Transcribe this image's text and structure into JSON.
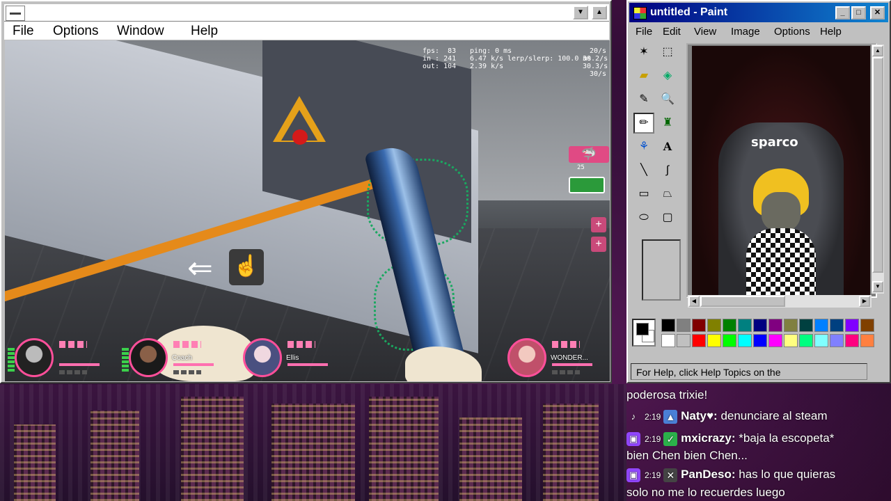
{
  "game_window": {
    "menu": [
      "File",
      "Options",
      "Window",
      "Help"
    ],
    "hud": {
      "fps": "fps:  83",
      "in": "in : 241",
      "out": "out: 104",
      "ping": "ping: 0 ms",
      "in_rate": "6.47 k/s",
      "out_rate": "2.39 k/s",
      "slerp": "lerp/slerp: 100.0 ms",
      "rate1": "20/s",
      "rate2": "30.2/s",
      "rate3": "30.3/s",
      "rate4": "30/s",
      "badge_count": "25"
    },
    "players": [
      {
        "name": ""
      },
      {
        "name": "Coach"
      },
      {
        "name": "Ellis"
      },
      {
        "name": "WONDER..."
      }
    ]
  },
  "paint": {
    "title": "untitled - Paint",
    "menu": [
      "File",
      "Edit",
      "View",
      "Image",
      "Options",
      "Help"
    ],
    "tools": [
      "free-form-select",
      "select",
      "eraser",
      "fill",
      "pick-color",
      "magnifier",
      "pencil",
      "brush",
      "airbrush",
      "text",
      "line",
      "curve",
      "rectangle",
      "polygon",
      "ellipse",
      "rounded-rectangle"
    ],
    "canvas_text": "sparco",
    "palette_top": [
      "#000000",
      "#808080",
      "#800000",
      "#808000",
      "#008000",
      "#008080",
      "#000080",
      "#800080",
      "#808040",
      "#004040",
      "#0080ff",
      "#004080",
      "#8000ff",
      "#804000"
    ],
    "palette_bottom": [
      "#ffffff",
      "#c0c0c0",
      "#ff0000",
      "#ffff00",
      "#00ff00",
      "#00ffff",
      "#0000ff",
      "#ff00ff",
      "#ffff80",
      "#00ff80",
      "#80ffff",
      "#8080ff",
      "#ff0080",
      "#ff8040"
    ],
    "status": "For Help, click Help Topics on the"
  },
  "chat": [
    {
      "platform": "",
      "time": "",
      "badge": "",
      "user": "",
      "message": "poderosa trixie!"
    },
    {
      "platform": "tiktok",
      "time": "2:19",
      "badge": "▲",
      "user": "Naty♥:",
      "message": "denunciare al steam"
    },
    {
      "platform": "twitch",
      "time": "2:19",
      "badge": "✓",
      "user": "mxicrazy:",
      "message": "*baja la escopeta*"
    },
    {
      "platform": "",
      "time": "",
      "badge": "",
      "user": "",
      "message": "bien Chen bien Chen..."
    },
    {
      "platform": "twitch",
      "time": "2:19",
      "badge": "✕",
      "user": "PanDeso:",
      "message": "has lo que quieras"
    },
    {
      "platform": "",
      "time": "",
      "badge": "",
      "user": "",
      "message": "solo no me lo recuerdes luego"
    }
  ]
}
